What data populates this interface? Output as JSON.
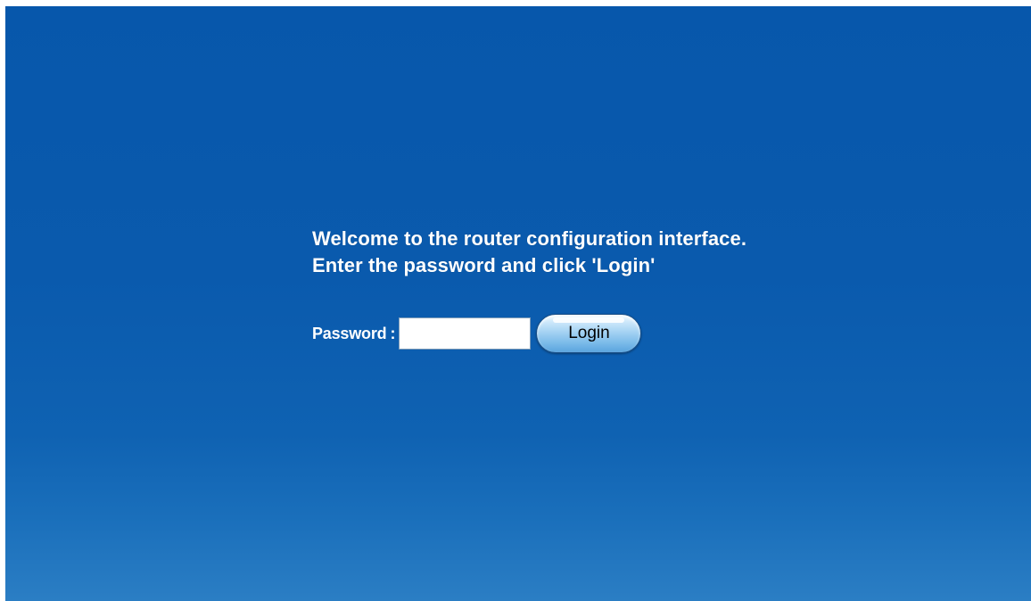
{
  "welcome": {
    "line1": "Welcome to the router configuration interface.",
    "line2": "Enter the password and click 'Login'"
  },
  "login_form": {
    "password_label": "Password",
    "colon": ":",
    "password_value": "",
    "login_button_label": "Login"
  },
  "colors": {
    "background_top": "#0757ab",
    "background_bottom": "#2b7ec4",
    "text": "#ffffff",
    "button_face": "#a6d3f3"
  }
}
